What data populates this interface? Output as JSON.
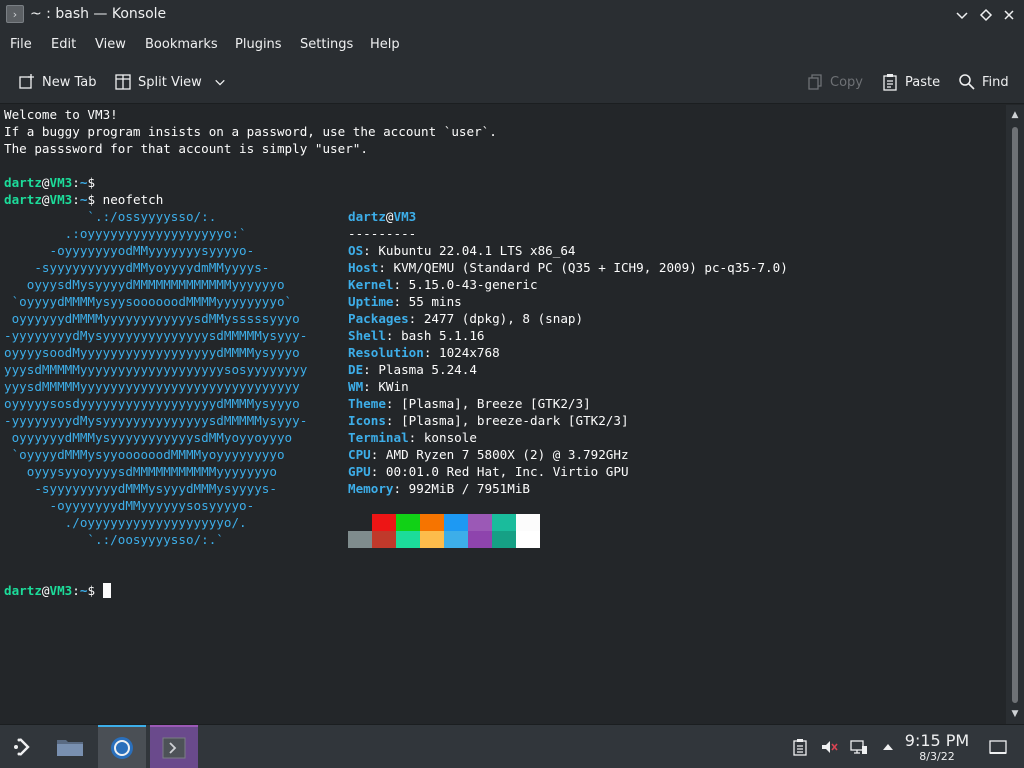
{
  "window": {
    "title": "~ : bash — Konsole"
  },
  "menubar": {
    "items": [
      "File",
      "Edit",
      "View",
      "Bookmarks",
      "Plugins",
      "Settings",
      "Help"
    ]
  },
  "toolbar": {
    "new_tab": "New Tab",
    "split_view": "Split View",
    "copy": "Copy",
    "paste": "Paste",
    "find": "Find"
  },
  "terminal": {
    "welcome": [
      "Welcome to VM3!",
      "If a buggy program insists on a password, use the account `user`.",
      "The passsword for that account is simply \"user\"."
    ],
    "prompt": {
      "user": "dartz",
      "at": "@",
      "host": "VM3",
      "colon": ":",
      "path": "~",
      "symbol": "$ "
    },
    "command": "neofetch",
    "logo": [
      "           `.:/ossyyyysso/:.",
      "        .:oyyyyyyyyyyyyyyyyyyo:`",
      "      -oyyyyyyyodMMyyyyyyysyyyyo-",
      "    -syyyyyyyyyydMMyoyyyydmMMyyyys-",
      "   oyyysdMysyyyydMMMMMMMMMMMMMyyyyyyo",
      " `oyyyydMMMMysyysoooooodMMMMyyyyyyyyo`",
      " oyyyyyydMMMMyyyyyyyyyyyysdMMysssssyyyo",
      "-yyyyyyyydMysyyyyyyyyyyyyyysdMMMMMysyyy-",
      "oyyyysoodMyyyyyyyyyyyyyyyyyydMMMMysyyyo",
      "yyysdMMMMMyyyyyyyyyyyyyyyyyyysosyyyyyyyy",
      "yyysdMMMMMyyyyyyyyyyyyyyyyyyyyyyyyyyyyy",
      "oyyyyysosdyyyyyyyyyyyyyyyyyydMMMMysyyyo",
      "-yyyyyyyydMysyyyyyyyyyyyyyysdMMMMMysyyy-",
      " oyyyyyydMMMysyyyyyyyyyyysdMMyoyyoyyyo",
      " `oyyyydMMMysyyoooooodMMMMyoyyyyyyyyo",
      "   oyyysyyoyyyysdMMMMMMMMMMMyyyyyyyo",
      "    -syyyyyyyyydMMMysyyydMMMysyyyys-",
      "      -oyyyyyyydMMyyyyyysosyyyyo-",
      "        ./oyyyyyyyyyyyyyyyyyyo/.",
      "           `.:/oosyyyysso/:.`"
    ],
    "info_header": {
      "user": "dartz",
      "at": "@",
      "host": "VM3",
      "separator": "---------"
    },
    "info": [
      {
        "key": "OS",
        "value": "Kubuntu 22.04.1 LTS x86_64"
      },
      {
        "key": "Host",
        "value": "KVM/QEMU (Standard PC (Q35 + ICH9, 2009) pc-q35-7.0)"
      },
      {
        "key": "Kernel",
        "value": "5.15.0-43-generic"
      },
      {
        "key": "Uptime",
        "value": "55 mins"
      },
      {
        "key": "Packages",
        "value": "2477 (dpkg), 8 (snap)"
      },
      {
        "key": "Shell",
        "value": "bash 5.1.16"
      },
      {
        "key": "Resolution",
        "value": "1024x768"
      },
      {
        "key": "DE",
        "value": "Plasma 5.24.4"
      },
      {
        "key": "WM",
        "value": "KWin"
      },
      {
        "key": "Theme",
        "value": "[Plasma], Breeze [GTK2/3]"
      },
      {
        "key": "Icons",
        "value": "[Plasma], breeze-dark [GTK2/3]"
      },
      {
        "key": "Terminal",
        "value": "konsole"
      },
      {
        "key": "CPU",
        "value": "AMD Ryzen 7 5800X (2) @ 3.792GHz"
      },
      {
        "key": "GPU",
        "value": "00:01.0 Red Hat, Inc. Virtio GPU"
      },
      {
        "key": "Memory",
        "value": "992MiB / 7951MiB"
      }
    ],
    "palette_top": [
      "#232629",
      "#ed1515",
      "#11d116",
      "#f67400",
      "#1d99f3",
      "#9b59b6",
      "#1abc9c",
      "#fcfcfc"
    ],
    "palette_bottom": [
      "#7f8c8d",
      "#c0392b",
      "#1cdc9a",
      "#fdbc4b",
      "#3daee9",
      "#8e44ad",
      "#16a085",
      "#ffffff"
    ]
  },
  "taskbar": {
    "time": "9:15 PM",
    "date": "8/3/22",
    "colors": {
      "accent": "#3daee9",
      "konsole_active": "#9b59b6"
    }
  }
}
